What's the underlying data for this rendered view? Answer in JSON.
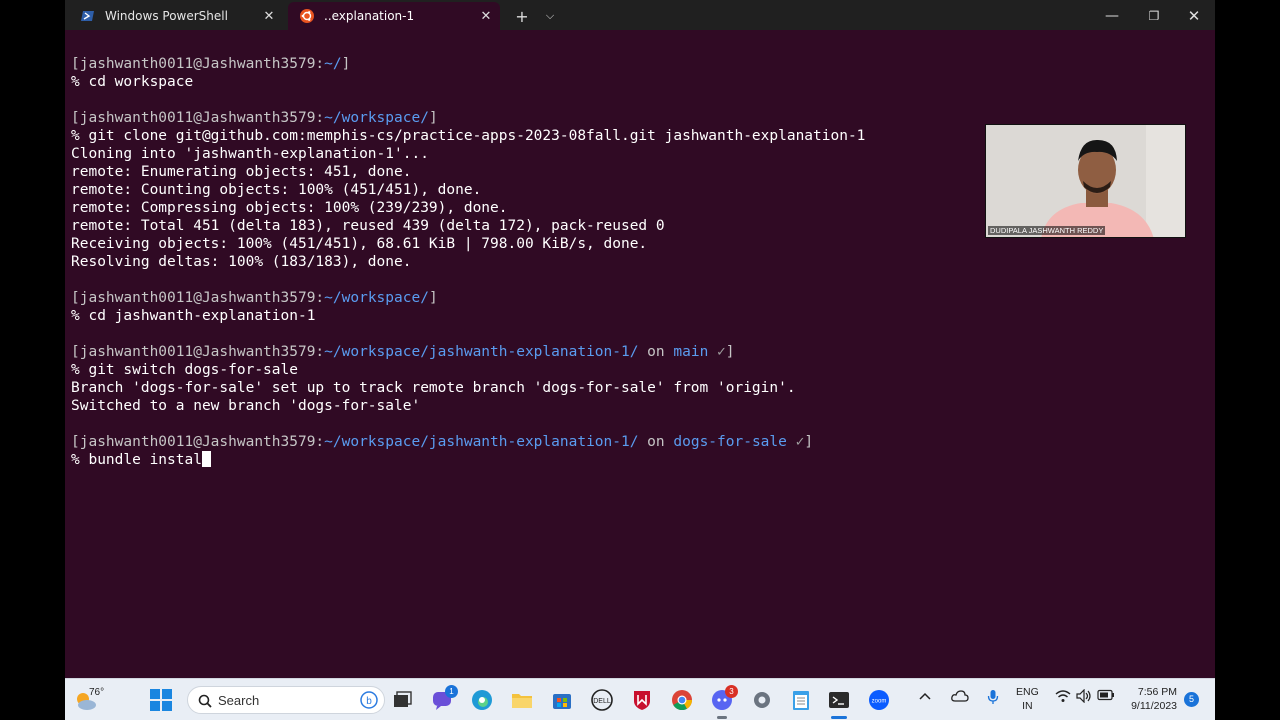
{
  "tabs": [
    {
      "label": "Windows PowerShell",
      "close": "✕"
    },
    {
      "label": "..explanation-1",
      "close": "✕"
    }
  ],
  "window_controls": {
    "new_tab": "+",
    "dropdown": "⌵",
    "minimize": "—",
    "maximize": "❐",
    "close": "✕"
  },
  "terminal": {
    "lines": [
      {
        "user": "[jashwanth0011@Jashwanth3579:",
        "path": "~/",
        "on": "",
        "branch": "",
        "check": "",
        "end": "]"
      },
      {
        "cmd": "% cd workspace"
      },
      {
        "blank": ""
      },
      {
        "user": "[jashwanth0011@Jashwanth3579:",
        "path": "~/workspace/",
        "on": "",
        "branch": "",
        "check": "",
        "end": "]"
      },
      {
        "cmd": "% git clone git@github.com:memphis-cs/practice-apps-2023-08fall.git jashwanth-explanation-1"
      },
      {
        "out": "Cloning into 'jashwanth-explanation-1'..."
      },
      {
        "out": "remote: Enumerating objects: 451, done."
      },
      {
        "out": "remote: Counting objects: 100% (451/451), done."
      },
      {
        "out": "remote: Compressing objects: 100% (239/239), done."
      },
      {
        "out": "remote: Total 451 (delta 183), reused 439 (delta 172), pack-reused 0"
      },
      {
        "out": "Receiving objects: 100% (451/451), 68.61 KiB | 798.00 KiB/s, done."
      },
      {
        "out": "Resolving deltas: 100% (183/183), done."
      },
      {
        "blank": ""
      },
      {
        "user": "[jashwanth0011@Jashwanth3579:",
        "path": "~/workspace/",
        "on": "",
        "branch": "",
        "check": "",
        "end": "]"
      },
      {
        "cmd": "% cd jashwanth-explanation-1"
      },
      {
        "blank": ""
      },
      {
        "user": "[jashwanth0011@Jashwanth3579:",
        "path": "~/workspace/jashwanth-explanation-1/",
        "on": " on ",
        "branch": "main",
        "check": " ✓",
        "end": "]"
      },
      {
        "cmd": "% git switch dogs-for-sale"
      },
      {
        "out": "Branch 'dogs-for-sale' set up to track remote branch 'dogs-for-sale' from 'origin'."
      },
      {
        "out": "Switched to a new branch 'dogs-for-sale'"
      },
      {
        "blank": ""
      },
      {
        "user": "[jashwanth0011@Jashwanth3579:",
        "path": "~/workspace/jashwanth-explanation-1/",
        "on": " on ",
        "branch": "dogs-for-sale",
        "check": " ✓",
        "end": "]"
      },
      {
        "cmd": "% bundle instal",
        "cursor": true
      }
    ]
  },
  "webcam": {
    "name": "DUDIPALA JASHWANTH REDDY"
  },
  "taskbar": {
    "weather_temp": "76°",
    "search_placeholder": "Search",
    "badges": {
      "chat": "1",
      "discord": "3"
    },
    "lang_top": "ENG",
    "lang_bottom": "IN",
    "time": "7:56 PM",
    "date": "9/11/2023",
    "notifications": "5",
    "colors": {
      "chrome_active": "#1a73e8",
      "badge_blue": "#1a73d9",
      "badge_red": "#d93025"
    }
  }
}
